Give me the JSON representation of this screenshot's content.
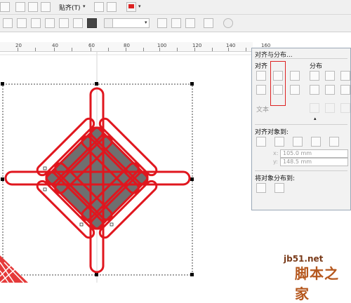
{
  "toolbar1": {
    "snap_label": "贴齐(T)",
    "dropdown_arrow": "▾"
  },
  "toolbar2": {
    "size_field_value": ""
  },
  "ruler": {
    "labels": [
      "20",
      "40",
      "60",
      "80",
      "100",
      "120",
      "140",
      "160"
    ]
  },
  "panel": {
    "title": "对齐与分布...",
    "align_heading": "对齐",
    "distribute_heading": "分布",
    "text_label": "文本",
    "text_dropdown_arrow": "▴",
    "align_to_heading": "对齐对象到:",
    "x_label": "x:",
    "x_value": "105.0 mm",
    "y_label": "y:",
    "y_value": "148.5 mm",
    "distribute_to_heading": "将对象分布到:"
  },
  "colors": {
    "knot_red": "#e0161e",
    "diamond_gray": "#6f6f6f",
    "highlight_red": "#d22222"
  },
  "watermark": {
    "site": "jb51.net",
    "name": "脚本之家"
  }
}
